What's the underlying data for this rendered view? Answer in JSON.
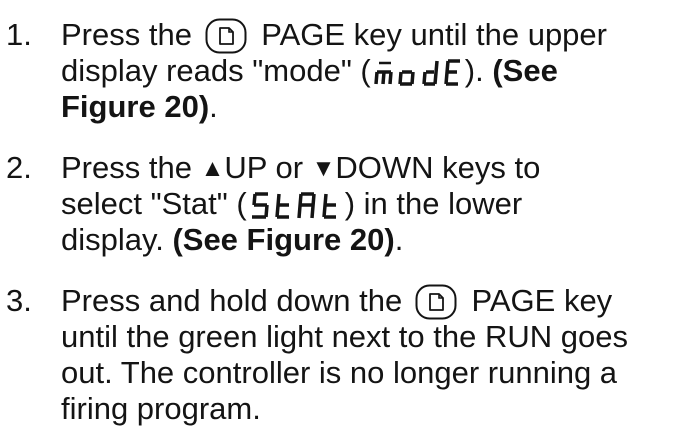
{
  "steps": [
    {
      "number": "1.",
      "lines": [
        {
          "pre": "Press the",
          "post": "PAGE key until the upper"
        },
        {
          "pre": "display reads \"mode\" (",
          "lcd": "mode-lcd",
          "post": ").",
          "bold": "(See"
        },
        {
          "bold": "Figure 20)",
          "post": "."
        }
      ]
    },
    {
      "number": "2.",
      "lines": [
        {
          "pre": "Press the",
          "up_icon": "▲",
          "up_label": "UP or",
          "down_icon": "▼",
          "down_label": "DOWN keys to"
        },
        {
          "pre": "select \"Stat\" (",
          "lcd": "stat-lcd",
          "post": ") in the lower"
        },
        {
          "pre": "display.",
          "bold": "(See Figure 20)",
          "post": "."
        }
      ]
    },
    {
      "number": "3.",
      "lines": [
        {
          "pre": "Press and hold down the",
          "post": "PAGE key"
        },
        {
          "pre": "until the green light next to the RUN goes"
        },
        {
          "pre": "out. The controller is no longer running a"
        },
        {
          "pre": "firing program."
        }
      ]
    }
  ],
  "icons": {
    "page_key": "page-key-icon",
    "up": "up-triangle-icon",
    "down": "down-triangle-icon"
  },
  "colors": {
    "text": "#141414",
    "background": "#ffffff"
  }
}
